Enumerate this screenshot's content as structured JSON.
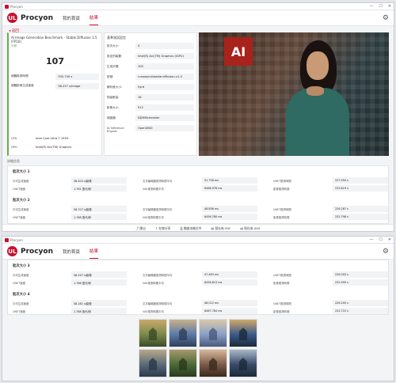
{
  "window": {
    "title": "Procyon",
    "min": "—",
    "max": "☐",
    "close": "✕"
  },
  "nav": {
    "brand": "Procyon",
    "tabs": [
      "我的首頁",
      "結果"
    ],
    "logo_text": "UL"
  },
  "back_label": "返回",
  "summary": {
    "title": "AI Image Generation Benchmark - Stable Diffusion 1.5 (FP16)",
    "score_label": "分數",
    "score": "107",
    "metrics": [
      {
        "label": "總體推測時間",
        "value": "532.749 s"
      },
      {
        "label": "總體影像生成速度",
        "value": "58.257 s/image"
      }
    ],
    "system": [
      {
        "label": "CPU",
        "value": "Intel Core Ultra 7 155H"
      },
      {
        "label": "GPU",
        "value": "Intel(R) Arc(TM) Graphics"
      }
    ]
  },
  "settings": {
    "title": "基準測試設定",
    "rows": [
      {
        "label": "批次大小:",
        "value": "4"
      },
      {
        "label": "設定的裝置:",
        "value": "Intel(R) Arc(TM) Graphics (iGPU)"
      },
      {
        "label": "生成步驟:",
        "value": "100"
      },
      {
        "label": "型號:",
        "value": "runwayml/stable-diffusion-v1-5"
      },
      {
        "label": "解析度大小:",
        "value": "5yrd"
      },
      {
        "label": "詞彙數量:",
        "value": "16"
      },
      {
        "label": "影像大小:",
        "value": "512"
      },
      {
        "label": "調度器:",
        "value": "DDIMScheduler"
      },
      {
        "label": "AI Inference Engine:",
        "value": "OpenVINO"
      }
    ]
  },
  "detail_title": "詳細信息",
  "batches": [
    {
      "title": "批次大小 1",
      "rows": [
        [
          "平均生成速度",
          "58.403 s/影像",
          "文字編碼器推測時間平均",
          "51.758 ms",
          "UNET推測時間",
          "227.094 s"
        ],
        [
          "UNET速度",
          "1.761 迭代/秒",
          "VAE推測時間平均",
          "6466.978 ms",
          "影像推測時間",
          "233.619 s"
        ]
      ]
    },
    {
      "title": "批次大小 2",
      "rows": [
        [
          "平均生成速度",
          "58.707 s/影像",
          "文字編碼器推測時間平均",
          "48.836 ms",
          "UNET推測時間",
          "226.287 s"
        ],
        [
          "UNET速度",
          "1.768 迭代/秒",
          "VAE推測時間平均",
          "6456.780 ms",
          "影像推測時間",
          "232.798 s"
        ]
      ]
    },
    {
      "title": "批次大小 3",
      "rows": [
        [
          "平均生成速度",
          "58.247 s/影像",
          "文字編碼器推測時間平均",
          "47.463 ms",
          "UNET推測時間",
          "226.003 s"
        ],
        [
          "UNET速度",
          "1.766 迭代/秒",
          "VAE推測時間平均",
          "6456.813 ms",
          "影像推測時間",
          "232.999 s"
        ]
      ]
    },
    {
      "title": "批次大小 4",
      "rows": [
        [
          "平均生成速度",
          "58.181 s/影像",
          "文字編碼器推測時間平均",
          "48.012 ms",
          "UNET推測時間",
          "226.205 s"
        ],
        [
          "UNET速度",
          "1.768 迭代/秒",
          "VAE推測時間平均",
          "6467.784 ms",
          "影像推測時間",
          "232.722 s"
        ]
      ]
    }
  ],
  "bottom_actions": [
    "匯出",
    "在線分享",
    "開啟本機文件",
    "保存為 PDF",
    "保存為 XML"
  ],
  "hero_logo_text": "AI",
  "colors": {
    "accent": "#c8102e",
    "green": "#6aa84f"
  }
}
